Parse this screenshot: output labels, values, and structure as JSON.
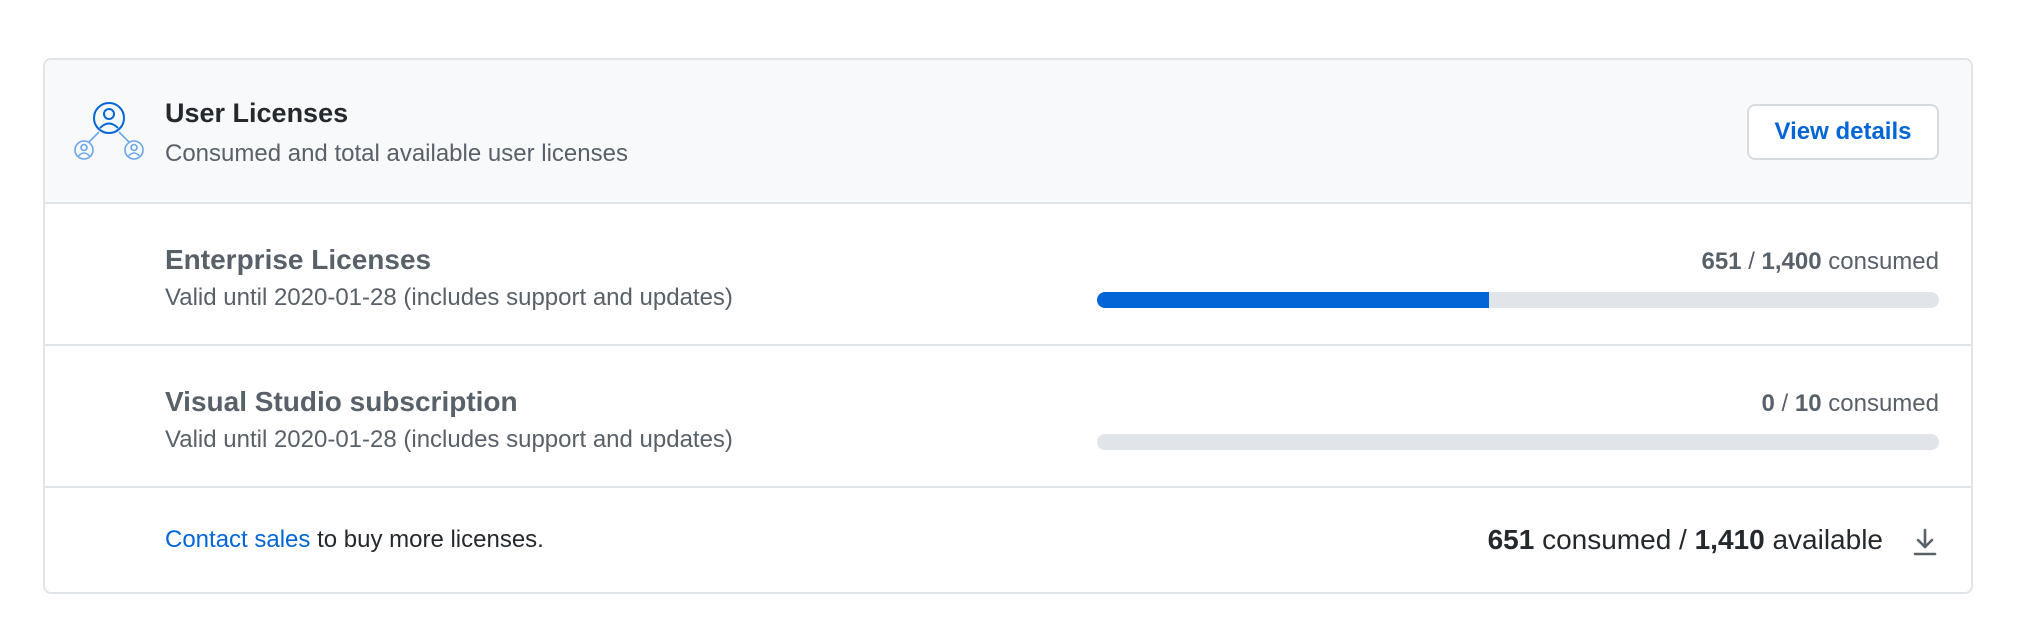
{
  "header": {
    "icon": "user-licenses-icon",
    "title": "User Licenses",
    "subtitle": "Consumed and total available user licenses",
    "view_details_label": "View details"
  },
  "licenses": [
    {
      "title": "Enterprise Licenses",
      "validity": "Valid until 2020-01-28 (includes support and updates)",
      "consumed": "651",
      "separator": "/",
      "total": "1,400",
      "suffix": "consumed",
      "fraction": 0.465
    },
    {
      "title": "Visual Studio subscription",
      "validity": "Valid until 2020-01-28 (includes support and updates)",
      "consumed": "0",
      "separator": "/",
      "total": "10",
      "suffix": "consumed",
      "fraction": 0
    }
  ],
  "footer": {
    "contact_link": "Contact sales",
    "contact_rest": " to buy more licenses.",
    "consumed": "651",
    "consumed_word": " consumed / ",
    "available": "1,410",
    "available_word": " available",
    "download_icon": "download-icon"
  },
  "colors": {
    "accent": "#0366d6",
    "bar_track": "#e1e4e8",
    "header_bg": "#f8f9fb"
  }
}
